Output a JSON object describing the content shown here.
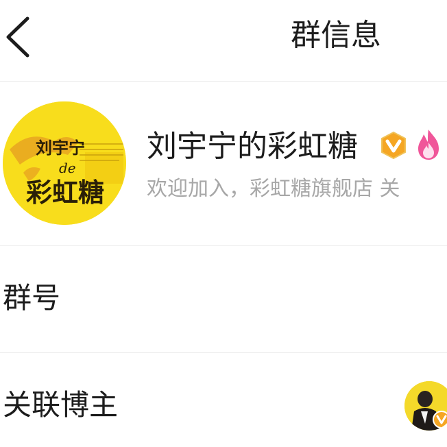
{
  "header": {
    "title": "群信息",
    "back_icon": "chevron-left-icon"
  },
  "group": {
    "name": "刘宇宁的彩虹糖",
    "description": "欢迎加入，彩虹糖旗舰店 关",
    "badges": [
      "vip-badge-icon",
      "fire-icon"
    ],
    "avatar": {
      "line1": "刘宇宁",
      "line2": "de",
      "line3": "彩虹糖",
      "bg_color": "#f8dd1c"
    }
  },
  "rows": {
    "group_number_label": "群号",
    "linked_blogger_label": "关联博主"
  },
  "colors": {
    "vip_orange": "#f5a623",
    "fire_pink": "#f0569a",
    "divider": "#ececec"
  }
}
